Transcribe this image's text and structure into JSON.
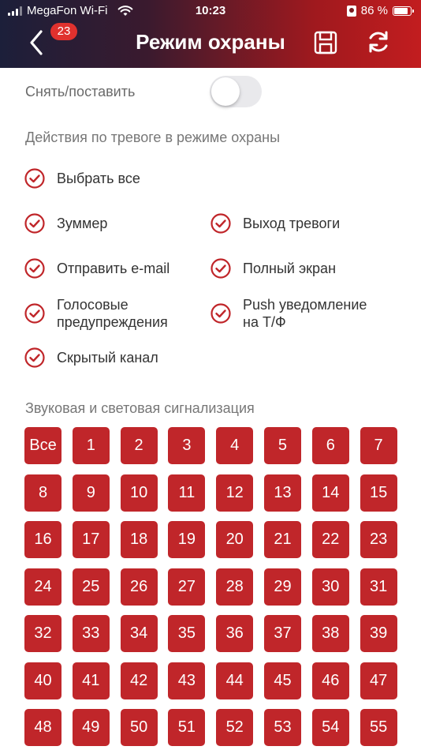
{
  "status_bar": {
    "carrier": "MegaFon Wi-Fi",
    "time": "10:23",
    "battery": "86 %",
    "battery_level": 0.86
  },
  "header": {
    "title": "Режим охраны",
    "badge": "23",
    "back_icon": "chevron-left-icon",
    "save_icon": "save-icon",
    "refresh_icon": "refresh-icon",
    "gradient_colors": [
      "#1c1f3a",
      "#a0191e",
      "#c21d1f"
    ]
  },
  "arm_toggle": {
    "label": "Снять/поставить",
    "on": false
  },
  "actions": {
    "title": "Действия по тревоге в режиме охраны",
    "select_all": "Выбрать все",
    "buzzer": "Зуммер",
    "alarm_output": "Выход тревоги",
    "send_email": "Отправить e-mail",
    "full_screen": "Полный экран",
    "voice_line1": "Голосовые",
    "voice_line2": "предупреждения",
    "push_line1": "Push уведомление",
    "push_line2": "на Т/Ф",
    "hidden_channel": "Скрытый канал",
    "check_color": "#c0262a"
  },
  "signals": {
    "title": "Звуковая и световая сигнализация",
    "cells": [
      "Все",
      "1",
      "2",
      "3",
      "4",
      "5",
      "6",
      "7",
      "8",
      "9",
      "10",
      "11",
      "12",
      "13",
      "14",
      "15",
      "16",
      "17",
      "18",
      "19",
      "20",
      "21",
      "22",
      "23",
      "24",
      "25",
      "26",
      "27",
      "28",
      "29",
      "30",
      "31",
      "32",
      "33",
      "34",
      "35",
      "36",
      "37",
      "38",
      "39",
      "40",
      "41",
      "42",
      "43",
      "44",
      "45",
      "46",
      "47",
      "48",
      "49",
      "50",
      "51",
      "52",
      "53",
      "54",
      "55"
    ],
    "cell_color": "#c0262a"
  }
}
